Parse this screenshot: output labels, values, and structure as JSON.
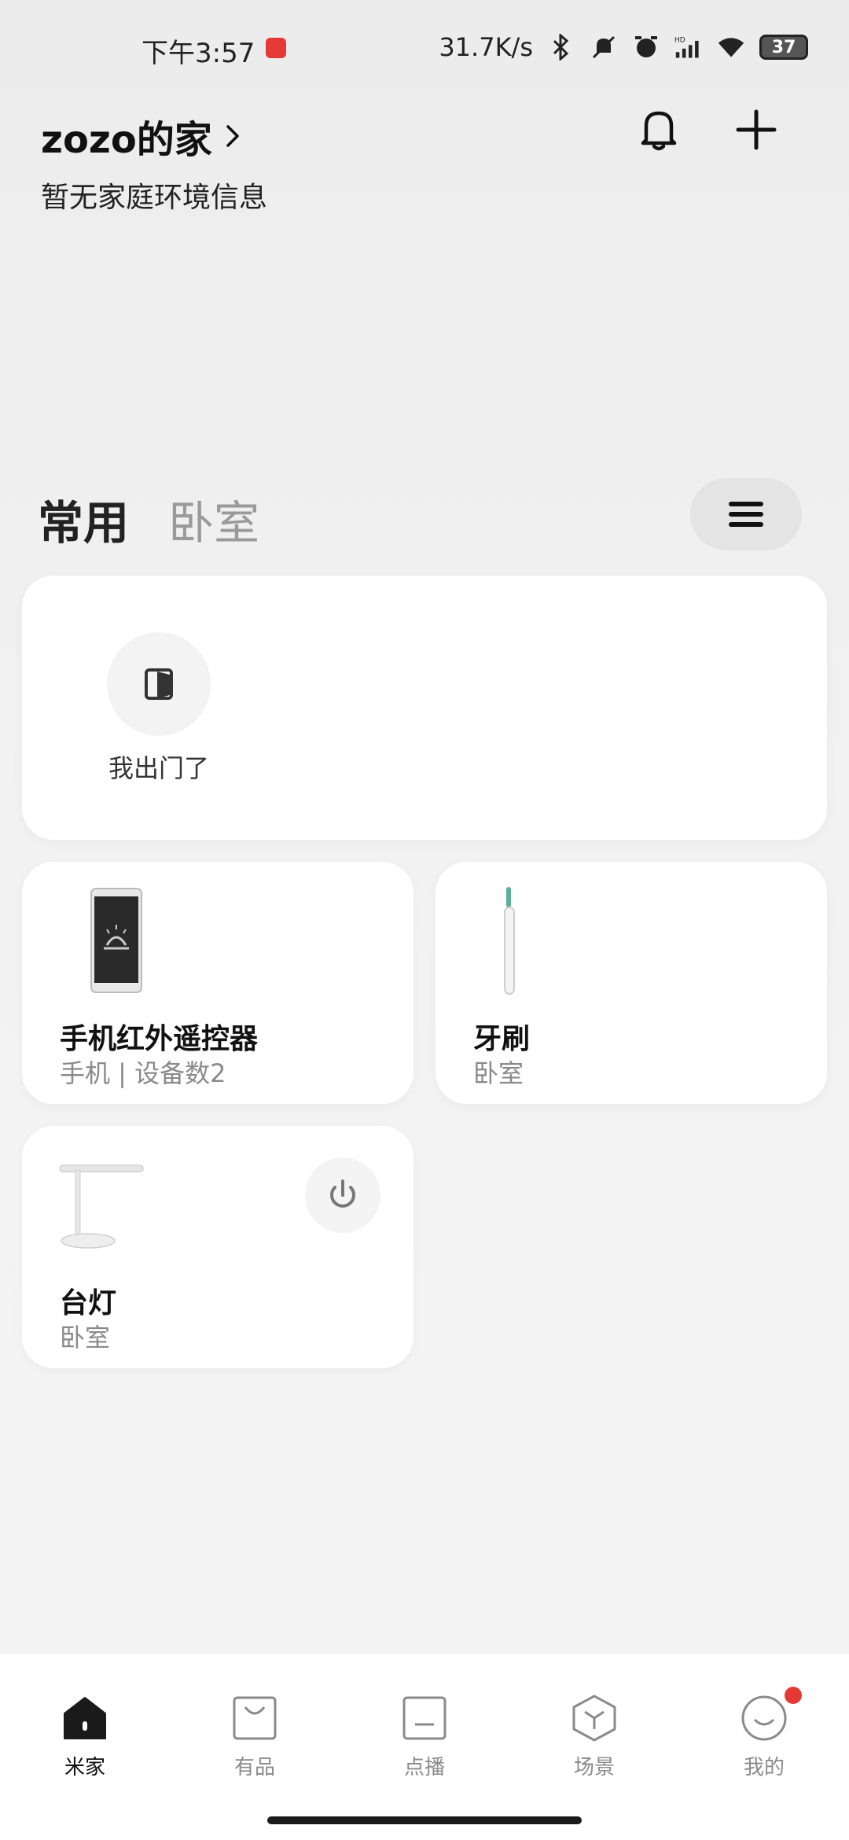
{
  "status_bar": {
    "time": "下午3:57",
    "net_speed": "31.7K/s",
    "battery": "37"
  },
  "header": {
    "home_name": "zozo的家",
    "env_info": "暂无家庭环境信息"
  },
  "tabs": [
    {
      "label": "常用",
      "active": true
    },
    {
      "label": "卧室",
      "active": false
    }
  ],
  "scene": {
    "label": "我出门了"
  },
  "devices": [
    {
      "name": "手机红外遥控器",
      "sub": "手机 | 设备数2",
      "icon": "phone-remote-image"
    },
    {
      "name": "牙刷",
      "sub": "卧室",
      "icon": "toothbrush-image"
    },
    {
      "name": "台灯",
      "sub": "卧室",
      "icon": "desk-lamp-image"
    }
  ],
  "bottom_nav": [
    {
      "label": "米家",
      "icon": "home-icon",
      "active": true
    },
    {
      "label": "有品",
      "icon": "shopping-bag-icon",
      "active": false
    },
    {
      "label": "点播",
      "icon": "media-icon",
      "active": false
    },
    {
      "label": "场景",
      "icon": "cube-icon",
      "active": false
    },
    {
      "label": "我的",
      "icon": "profile-smile-icon",
      "active": false
    }
  ],
  "colors": {
    "accent_badge": "#e53935",
    "card_bg": "#ffffff",
    "inactive_text": "#8a8a8a"
  }
}
